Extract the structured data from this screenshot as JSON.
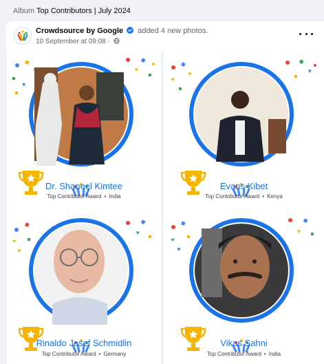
{
  "album": {
    "prefix": "Album",
    "title": "Top Contributors | July 2024"
  },
  "post": {
    "page_name": "Crowdsource by Google",
    "action": "added 4 new photos.",
    "timestamp": "10 September at 09:08",
    "separator": "·"
  },
  "award_label": "Top Contributor Award",
  "bullet": "•",
  "colors": {
    "link_blue": "#1a73e8",
    "ring_blue": "#1a73e8",
    "trophy_gold": "#f4b400",
    "text_secondary": "#65676b"
  },
  "photos": [
    {
      "name": "Dr. Shaneel Kimtee",
      "award": "Top Contributor Award",
      "country": "India"
    },
    {
      "name": "Evans Kibet",
      "award": "Top Contributor Award",
      "country": "Kenya"
    },
    {
      "name": "Rinaldo Josef Schmidlin",
      "award": "Top Contributor Award",
      "country": "Germany"
    },
    {
      "name": "Vikas Sahni",
      "award": "Top Contributor Award",
      "country": "India"
    }
  ],
  "icons": [
    "crowdsource-logo-icon",
    "verified-badge-icon",
    "globe-icon",
    "more-options-icon",
    "trophy-icon"
  ]
}
